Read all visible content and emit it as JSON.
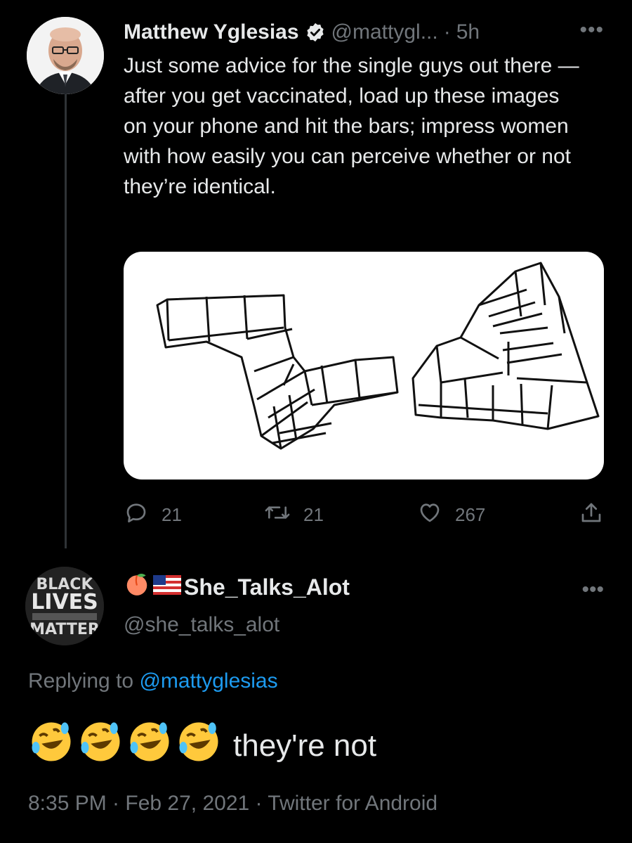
{
  "tweet": {
    "author_name": "Matthew Yglesias",
    "handle": "@mattygl...",
    "separator": "·",
    "time": "5h",
    "more": "•••",
    "text": "Just some advice for the single guys out there — after you get vaccinated, load up these images on your phone and hit the bars; impress women with how easily you can perceive whether or not they’re identical.",
    "replies": "21",
    "retweets": "21",
    "likes": "267"
  },
  "reply": {
    "author_name": "She_Talks_Alot",
    "handle": "@she_talks_alot",
    "more": "•••",
    "replying_prefix": "Replying to ",
    "replying_to": "@mattyglesias",
    "text": "they're not",
    "timestamp": "8:35 PM · Feb 27, 2021 · Twitter for Android",
    "avatar_text": [
      "BLACK",
      "LIVES",
      "MATTER"
    ]
  },
  "colors": {
    "background": "#000000",
    "text": "#e7e9ea",
    "secondary": "#71767b",
    "link": "#1d9bf0"
  },
  "icons": [
    "verified-icon",
    "reply-icon",
    "retweet-icon",
    "like-icon",
    "share-icon",
    "peach-emoji-icon",
    "us-flag-icon",
    "rofl-emoji-icon"
  ]
}
